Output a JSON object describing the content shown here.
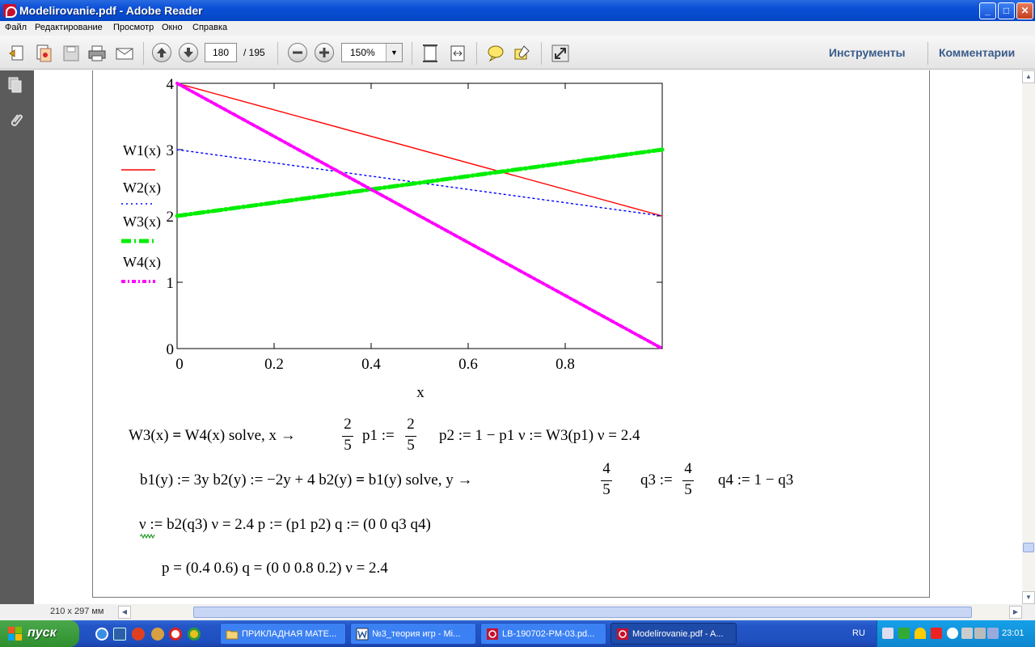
{
  "window": {
    "title": "Modelirovanie.pdf - Adobe Reader",
    "minimize": "_",
    "maximize": "□",
    "close": "✕"
  },
  "menu": {
    "items": [
      "Файл",
      "Редактирование",
      "Просмотр",
      "Окно",
      "Справка"
    ]
  },
  "toolbar": {
    "page_current": "180",
    "page_total": "/ 195",
    "zoom": "150%",
    "tools_label": "Инструменты",
    "comments_label": "Комментарии",
    "icons": [
      "create-pdf-icon",
      "combine-icon",
      "save-icon",
      "print-icon",
      "email-icon",
      "page-up-icon",
      "page-down-icon",
      "zoom-out-icon",
      "zoom-in-icon",
      "fit-page-icon",
      "fit-width-icon",
      "comment-icon",
      "highlight-icon",
      "fullscreen-icon"
    ]
  },
  "status": {
    "page_size": "210 x 297 мм"
  },
  "chart_data": {
    "type": "line",
    "title": "",
    "xlabel": "x",
    "ylabel": "",
    "xlim": [
      0,
      1
    ],
    "ylim": [
      0,
      4
    ],
    "x_ticks": [
      "0",
      "0.2",
      "0.4",
      "0.6",
      "0.8"
    ],
    "y_ticks": [
      "0",
      "1",
      "2",
      "3",
      "4"
    ],
    "grid": false,
    "legend_position": "left",
    "series": [
      {
        "name": "W1(x)",
        "color": "#ff0000",
        "style": "solid",
        "points": [
          [
            0,
            4
          ],
          [
            1,
            2
          ]
        ]
      },
      {
        "name": "W2(x)",
        "color": "#0000ff",
        "style": "dotted",
        "points": [
          [
            0,
            3
          ],
          [
            1,
            2
          ]
        ]
      },
      {
        "name": "W3(x)",
        "color": "#00ee00",
        "style": "dashed-thick",
        "points": [
          [
            0,
            2
          ],
          [
            1,
            3
          ]
        ]
      },
      {
        "name": "W4(x)",
        "color": "#ff00ff",
        "style": "dash-dot-thick",
        "points": [
          [
            0,
            4
          ],
          [
            1,
            0
          ]
        ]
      }
    ]
  },
  "legend": {
    "w1": "W1(x)",
    "w2": "W2(x)",
    "w3": "W3(x)",
    "w4": "W4(x)"
  },
  "formulas": {
    "line1_a": "W3(x) ",
    "line1_eq": "=",
    "line1_b": " W4(x)  solve, x  →",
    "line1_frac1_num": "2",
    "line1_frac1_den": "5",
    "line1_c": "p1 :=",
    "line1_frac2_num": "2",
    "line1_frac2_den": "5",
    "line1_d": "p2 := 1 − p1   ν := W3(p1)   ν = 2.4",
    "line2_a": "b1(y) := 3y      b2(y) := −2y + 4     b2(y) ",
    "line2_eq": "=",
    "line2_b": " b1(y)  solve, y  →",
    "line2_frac1_num": "4",
    "line2_frac1_den": "5",
    "line2_c": "q3 :=",
    "line2_frac2_num": "4",
    "line2_frac2_den": "5",
    "line2_d": "q4 := 1 − q3",
    "line3": "ν := b2(q3)      ν = 2.4      p := (p1   p2)      q := (0   0   q3   q4)",
    "line4": "p = (0.4   0.6)        q = (0   0   0.8   0.2)        ν = 2.4"
  },
  "taskbar": {
    "start": "пуск",
    "tasks": [
      {
        "label": "ПРИКЛАДНАЯ МАТЕ...",
        "icon": "folder-icon"
      },
      {
        "label": "№3_теория игр - Mi...",
        "icon": "word-icon"
      },
      {
        "label": "LB-190702-PM-03.pd...",
        "icon": "pdf-icon"
      },
      {
        "label": "Modelirovanie.pdf - A...",
        "icon": "pdf-icon"
      }
    ],
    "lang": "RU",
    "clock": "23:01"
  }
}
